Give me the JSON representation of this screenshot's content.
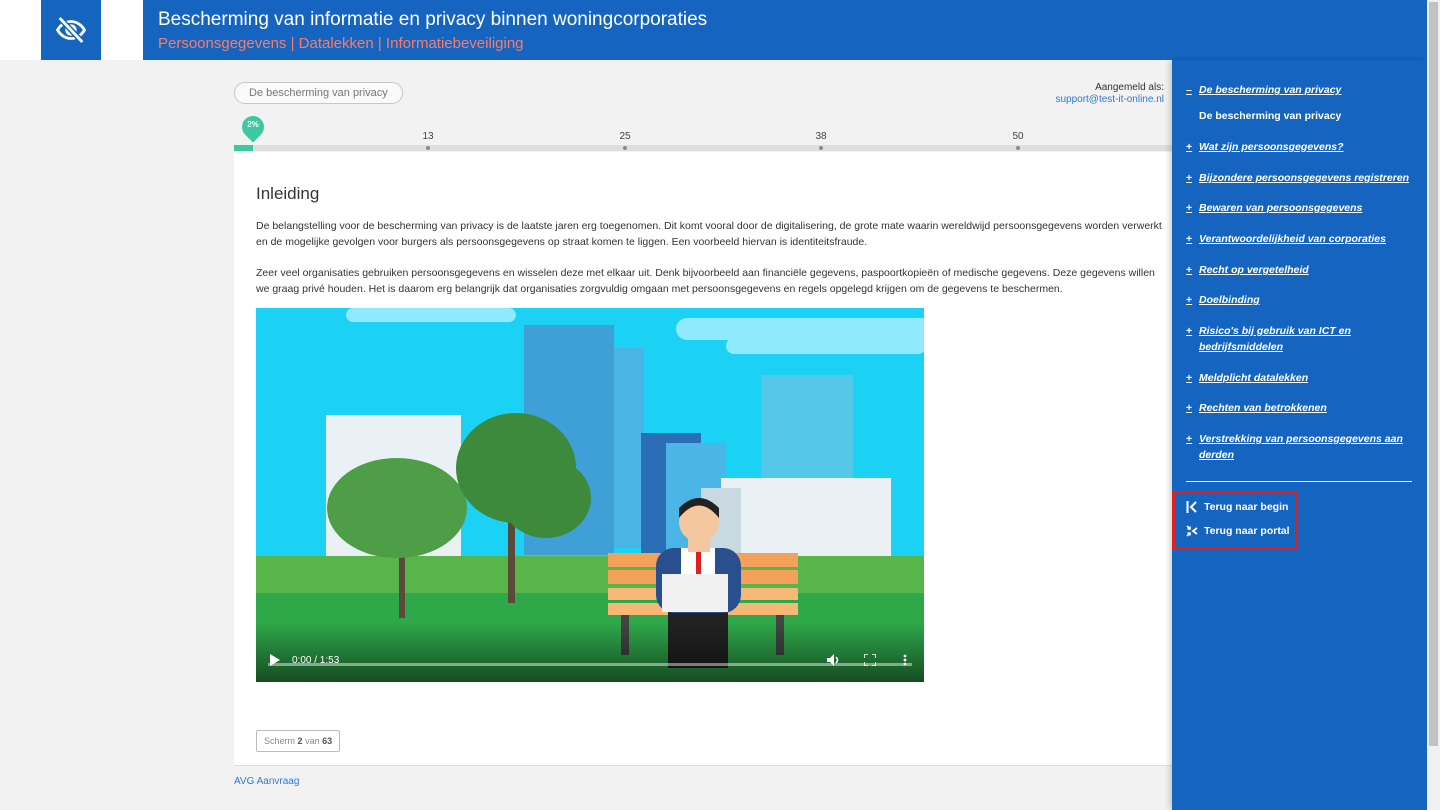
{
  "header": {
    "title": "Bescherming van informatie en privacy binnen woningcorporaties",
    "subtitle": "Persoonsgegevens | Datalekken | Informatiebeveiliging",
    "logo_icon": "eye-off-icon"
  },
  "breadcrumb": {
    "label": "De bescherming van privacy"
  },
  "account": {
    "label": "Aangemeld als:",
    "email": "support@test-it-online.nl"
  },
  "progress": {
    "percent_label": "2%",
    "fraction": 0.02,
    "ticks": [
      "13",
      "25",
      "38",
      "50"
    ]
  },
  "content": {
    "heading": "Inleiding",
    "paragraph1": "De belangstelling voor de bescherming van privacy is de laatste jaren erg toegenomen. Dit komt vooral door de digitalisering, de grote mate waarin wereldwijd persoonsgegevens worden verwerkt en de mogelijke gevolgen voor burgers als persoonsgegevens op straat komen te liggen. Een voorbeeld hiervan is identiteitsfraude.",
    "paragraph2": "Zeer veel organisaties gebruiken persoonsgegevens en wisselen deze met elkaar uit. Denk bijvoorbeeld aan financiële gegevens, paspoortkopieën of medische gegevens. Deze gegevens willen we graag privé houden. Het is daarom erg belangrijk dat organisaties zorgvuldig omgaan met persoonsgegevens en regels opgelegd krijgen om de gegevens te beschermen."
  },
  "video": {
    "time": "0:00 / 1:53"
  },
  "pager": {
    "prefix": "Scherm",
    "current": "2",
    "middle": "van",
    "total": "63"
  },
  "footer": {
    "link": "AVG Aanvraag"
  },
  "sidebar": {
    "active_item": "De bescherming van privacy",
    "active_sub": "De bescherming van privacy",
    "items": [
      "Wat zijn persoonsgegevens?",
      "Bijzondere persoonsgegevens registreren",
      "Bewaren van persoonsgegevens",
      "Verantwoordelijkheid van corporaties",
      "Recht op vergetelheid",
      "Doelbinding",
      "Risico's bij gebruik van ICT en bedrijfsmiddelen",
      "Meldplicht datalekken",
      "Rechten van betrokkenen",
      "Verstrekking van persoonsgegevens aan derden"
    ],
    "actions": {
      "back_start": "Terug naar begin",
      "back_portal": "Terug naar portal"
    }
  },
  "colors": {
    "brand": "#1565c0",
    "accent": "#3cc8a0",
    "subtitle": "#ff7a66",
    "highlight": "#e0201e"
  }
}
